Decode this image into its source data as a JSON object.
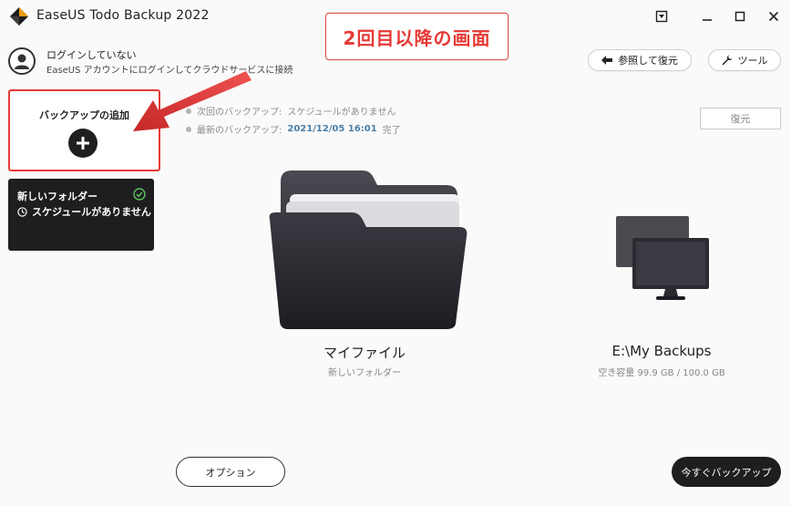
{
  "titlebar": {
    "title": "EaseUS Todo Backup 2022",
    "icons": [
      "app-logo-icon",
      "dropdown-menu-icon",
      "minimize-icon",
      "maximize-icon",
      "close-icon"
    ]
  },
  "account": {
    "status": "ログインしていない",
    "description": "EaseUS アカウントにログインしてクラウドサービスに接続"
  },
  "toolbar": {
    "browse_restore_label": "参照して復元",
    "tools_label": "ツール"
  },
  "annotation": {
    "banner_text": "2回目以降の画面"
  },
  "sidebar": {
    "add_backup_label": "バックアップの追加",
    "tasks": [
      {
        "name": "新しいフォルダー",
        "schedule": "スケジュールがありません"
      }
    ]
  },
  "status": {
    "next_backup_label": "次回のバックアップ:",
    "next_backup_value": "スケジュールがありません",
    "last_backup_label": "最新のバックアップ:",
    "last_backup_date": "2021/12/05 16:01",
    "last_backup_result": "完了"
  },
  "restore_label": "復元",
  "source": {
    "title": "マイファイル",
    "subtitle": "新しいフォルダー"
  },
  "destination": {
    "title": "E:\\My Backups",
    "subtitle": "空き容量 99.9 GB / 100.0 GB"
  },
  "footer": {
    "options_label": "オプション",
    "backup_now_label": "今すぐバックアップ"
  },
  "colors": {
    "accent_red": "#e53935",
    "dark": "#1e1e21",
    "status_blue": "#4a7fa8",
    "check_green": "#5cc45c"
  }
}
